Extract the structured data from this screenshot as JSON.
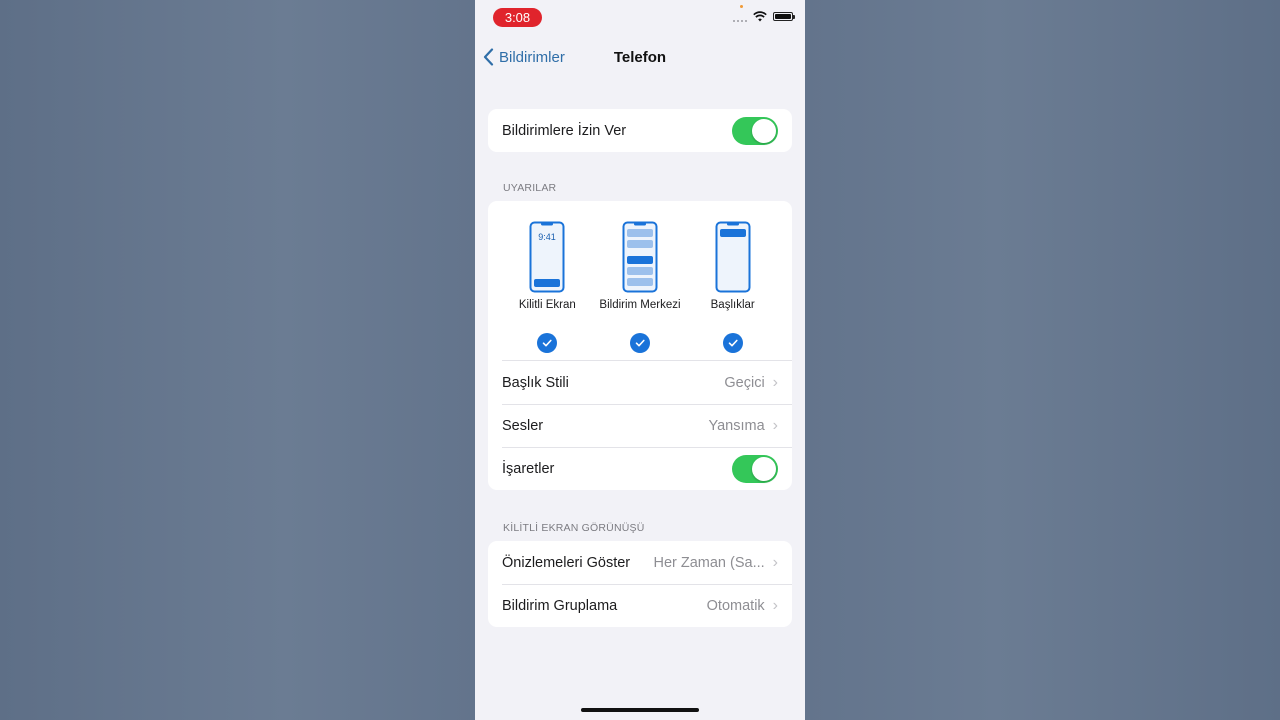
{
  "status": {
    "time": "3:08"
  },
  "nav": {
    "back_label": "Bildirimler",
    "title": "Telefon"
  },
  "allow": {
    "label": "Bildirimlere İzin Ver",
    "on": true
  },
  "alerts": {
    "header": "UYARILAR",
    "options": [
      {
        "label": "Kilitli Ekran",
        "time": "9:41",
        "checked": true
      },
      {
        "label": "Bildirim Merkezi",
        "checked": true
      },
      {
        "label": "Başlıklar",
        "checked": true
      }
    ],
    "rows": [
      {
        "label": "Başlık Stili",
        "value": "Geçici"
      },
      {
        "label": "Sesler",
        "value": "Yansıma"
      },
      {
        "label": "İşaretler",
        "on": true
      }
    ]
  },
  "lockscreen": {
    "header": "KİLİTLİ EKRAN GÖRÜNÜŞÜ",
    "rows": [
      {
        "label": "Önizlemeleri Göster",
        "value": "Her Zaman (Sa..."
      },
      {
        "label": "Bildirim Gruplama",
        "value": "Otomatik"
      }
    ]
  },
  "colors": {
    "accent": "#2f6ea8",
    "toggle_on": "#34c759",
    "check": "#1a73d9",
    "time_pill": "#e0242c",
    "background": "#64758c"
  }
}
